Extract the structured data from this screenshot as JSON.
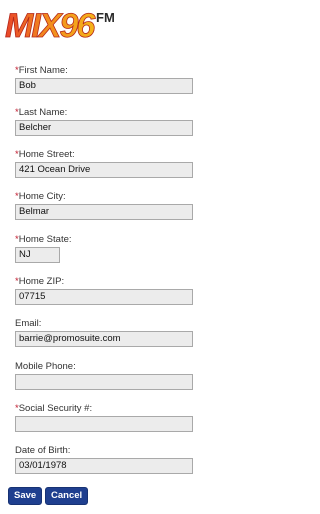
{
  "logo": {
    "text": "MIX96",
    "superscript": "FM"
  },
  "required_marker": "*",
  "fields": [
    {
      "label": "First Name:",
      "value": "Bob",
      "required": true
    },
    {
      "label": "Last Name:",
      "value": "Belcher",
      "required": true
    },
    {
      "label": "Home Street:",
      "value": "421 Ocean Drive",
      "required": true
    },
    {
      "label": "Home City:",
      "value": "Belmar",
      "required": true
    },
    {
      "label": "Home State:",
      "value": "NJ",
      "required": true
    },
    {
      "label": "Home ZIP:",
      "value": "07715",
      "required": true
    },
    {
      "label": "Email:",
      "value": "barrie@promosuite.com",
      "required": false
    },
    {
      "label": "Mobile Phone:",
      "value": "",
      "required": false
    },
    {
      "label": "Social Security #:",
      "value": "",
      "required": true
    },
    {
      "label": "Date of Birth:",
      "value": "03/01/1978",
      "required": false
    }
  ],
  "buttons": {
    "save": "Save",
    "cancel": "Cancel"
  },
  "colors": {
    "required": "#c0192c",
    "button": "#1f3f8f"
  }
}
